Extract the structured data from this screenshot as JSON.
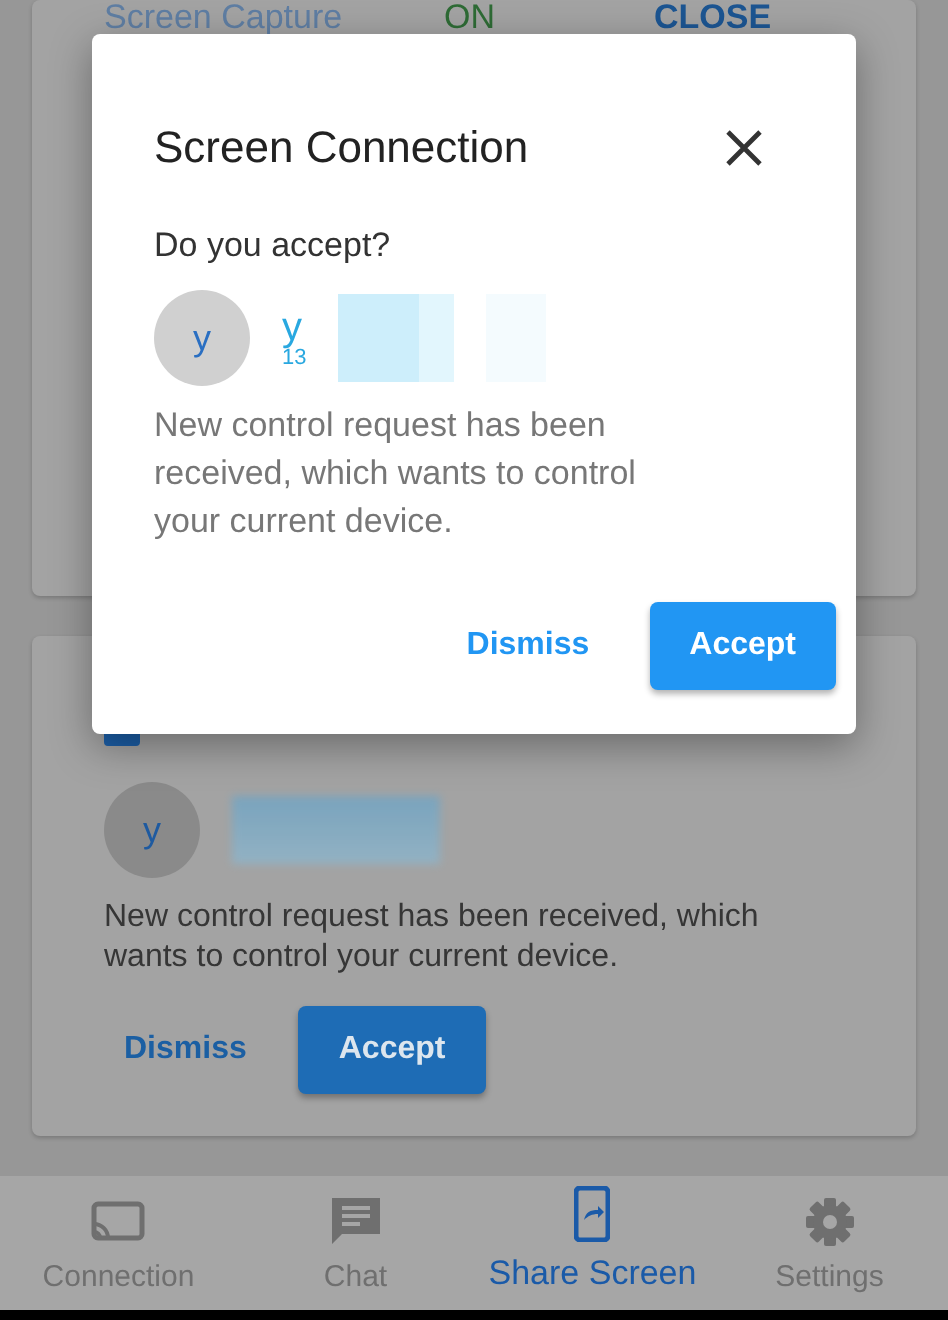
{
  "background": {
    "capture_row": {
      "label": "Screen Capture",
      "status": "ON",
      "action": "CLOSE"
    },
    "request_card": {
      "avatar": "y",
      "message": "New control request has been received, which wants to control your current device.",
      "buttons": [
        {
          "label": "Dismiss",
          "kind": "text"
        },
        {
          "label": "Accept",
          "kind": "filled"
        }
      ]
    }
  },
  "dialog": {
    "title": "Screen Connection",
    "question": "Do you accept?",
    "user": {
      "avatar": "y",
      "name": "y",
      "id": "13"
    },
    "message": "New control request has been received, which wants to control your current device.",
    "buttons": [
      {
        "label": "Dismiss",
        "kind": "text"
      },
      {
        "label": "Accept",
        "kind": "filled"
      }
    ]
  },
  "nav": [
    {
      "label": "Connection",
      "kind": "cast",
      "selected": false
    },
    {
      "label": "Chat",
      "kind": "chat",
      "selected": false
    },
    {
      "label": "Share Screen",
      "kind": "share",
      "selected": true
    },
    {
      "label": "Settings",
      "kind": "settings",
      "selected": false
    }
  ]
}
